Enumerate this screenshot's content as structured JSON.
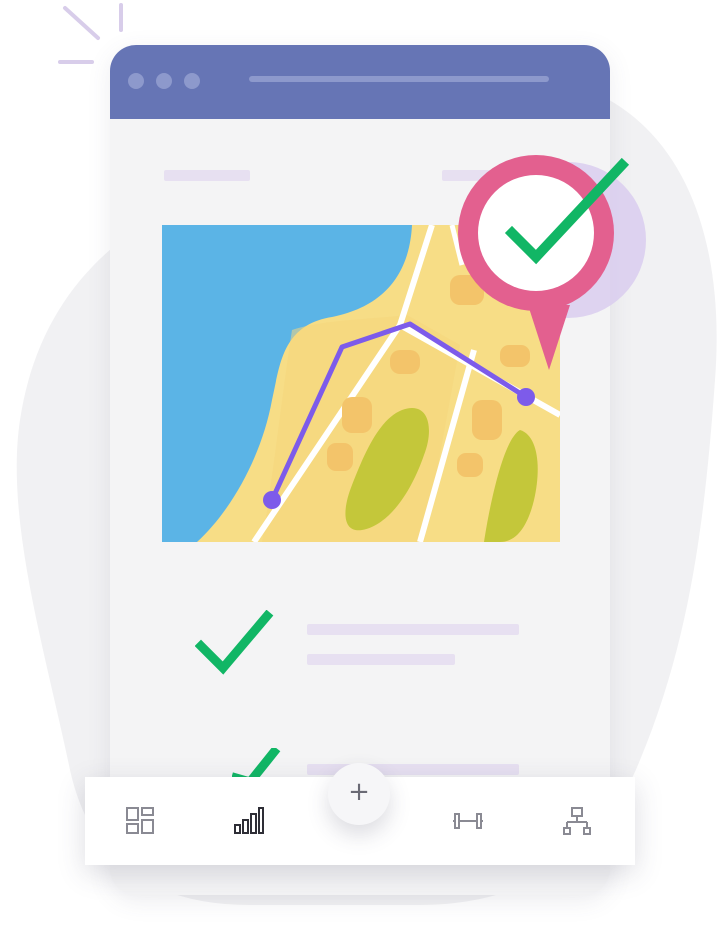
{
  "colors": {
    "header": "#6675b5",
    "screen_background": "#f4f4f5",
    "placeholder_line": "#e7e0f1",
    "check": "#11b665",
    "route": "#7d5bea",
    "pin": "#e3608f",
    "water": "#5bb4e6",
    "land": "#f7dd86",
    "park": "#c4c73a",
    "nav_icon": "#8a8a93",
    "nav_icon_active": "#2e2e36"
  },
  "window": {
    "traffic_dots": [
      "dot-1",
      "dot-2",
      "dot-3"
    ]
  },
  "map": {
    "pin_icon": "check-icon",
    "route_icon": "route-line"
  },
  "checklist": {
    "items": [
      {
        "icon": "check-icon"
      },
      {
        "icon": "check-icon"
      }
    ]
  },
  "bottom_nav": {
    "items": [
      {
        "icon": "dashboard-icon",
        "active": false
      },
      {
        "icon": "bar-chart-icon",
        "active": true
      },
      {
        "icon": "dumbbell-icon",
        "active": false
      },
      {
        "icon": "network-icon",
        "active": false
      }
    ],
    "fab": {
      "icon": "plus-icon",
      "glyph": "+"
    }
  }
}
